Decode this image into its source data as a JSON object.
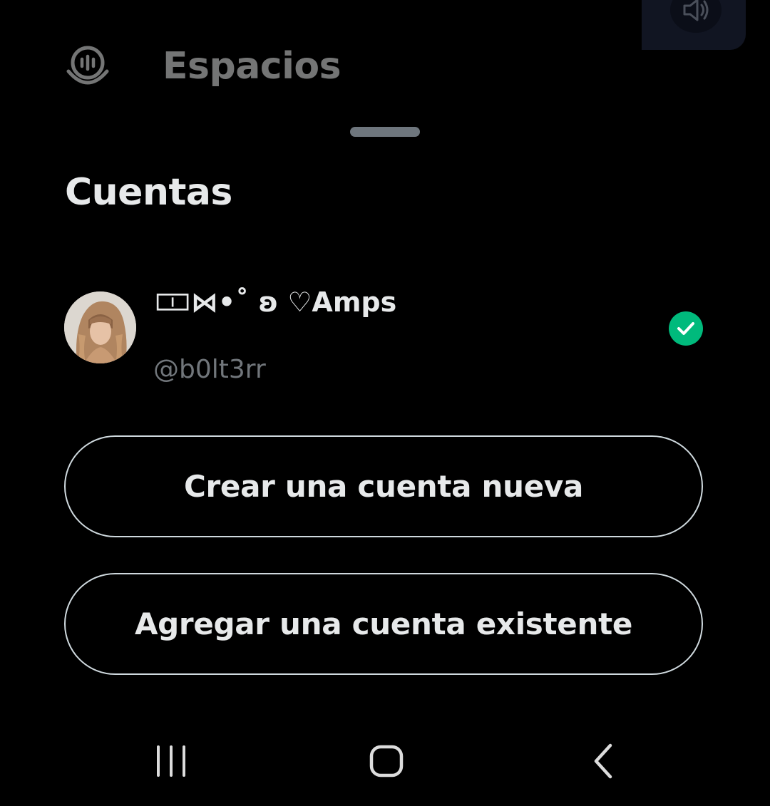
{
  "background_menu": {
    "item_label": "Espacios",
    "item_icon": "spaces-microphone-icon"
  },
  "mini_player": {
    "icon": "speaker-icon"
  },
  "sheet": {
    "title": "Cuentas",
    "accounts": [
      {
        "display_name": "🀱⋈•˚ ʚ ♡Amps",
        "handle": "@b0lt3rr",
        "selected": true,
        "avatar_icon": "profile-photo",
        "status_icon": "checkmark-icon"
      }
    ],
    "create_button_label": "Crear una cuenta nueva",
    "add_button_label": "Agregar una cuenta existente"
  },
  "nav_bar": {
    "recents_icon": "recent-apps-icon",
    "home_icon": "home-icon",
    "back_icon": "back-icon"
  },
  "colors": {
    "background": "#000000",
    "text_primary": "#e7e9ea",
    "text_secondary": "#71767b",
    "success": "#00ba7c",
    "button_border": "#cfd9de",
    "handle": "#6e767d"
  }
}
